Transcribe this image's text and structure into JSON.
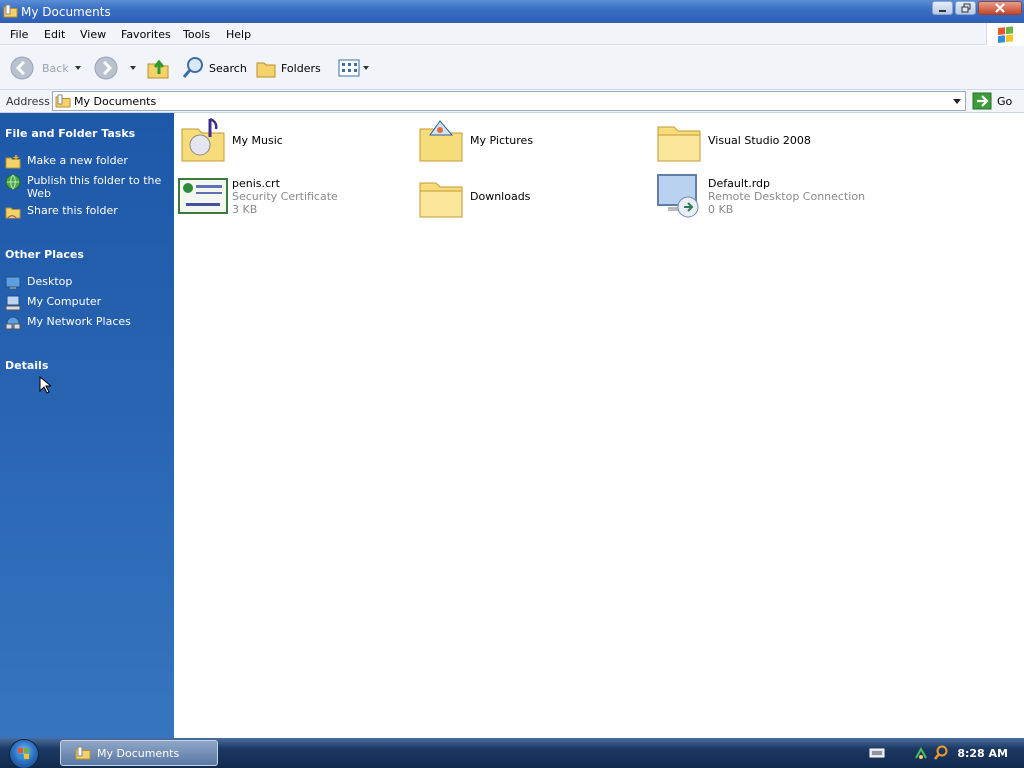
{
  "window": {
    "title": "My Documents"
  },
  "menu": [
    "File",
    "Edit",
    "View",
    "Favorites",
    "Tools",
    "Help"
  ],
  "toolbar": {
    "back_label": "Back",
    "search_label": "Search",
    "folders_label": "Folders"
  },
  "address": {
    "label": "Address",
    "value": "My Documents",
    "go_label": "Go"
  },
  "taskpane": {
    "file_folder_tasks": {
      "heading": "File and Folder Tasks",
      "items": [
        "Make a new folder",
        "Publish this folder to the Web",
        "Share this folder"
      ]
    },
    "other_places": {
      "heading": "Other Places",
      "items": [
        "Desktop",
        "My Computer",
        "My Network Places"
      ]
    },
    "details": {
      "heading": "Details"
    }
  },
  "files": [
    {
      "name": "My Music",
      "icon": "music-folder-icon"
    },
    {
      "name": "My Pictures",
      "icon": "pictures-folder-icon"
    },
    {
      "name": "Visual Studio 2008",
      "icon": "folder-icon"
    },
    {
      "name": "penis.crt",
      "type": "Security Certificate",
      "size": "3 KB",
      "icon": "certificate-icon"
    },
    {
      "name": "Downloads",
      "icon": "folder-icon"
    },
    {
      "name": "Default.rdp",
      "type": "Remote Desktop Connection",
      "size": "0 KB",
      "icon": "remote-desktop-icon"
    }
  ],
  "taskbar": {
    "active_task": "My Documents",
    "clock": "8:28 AM"
  }
}
